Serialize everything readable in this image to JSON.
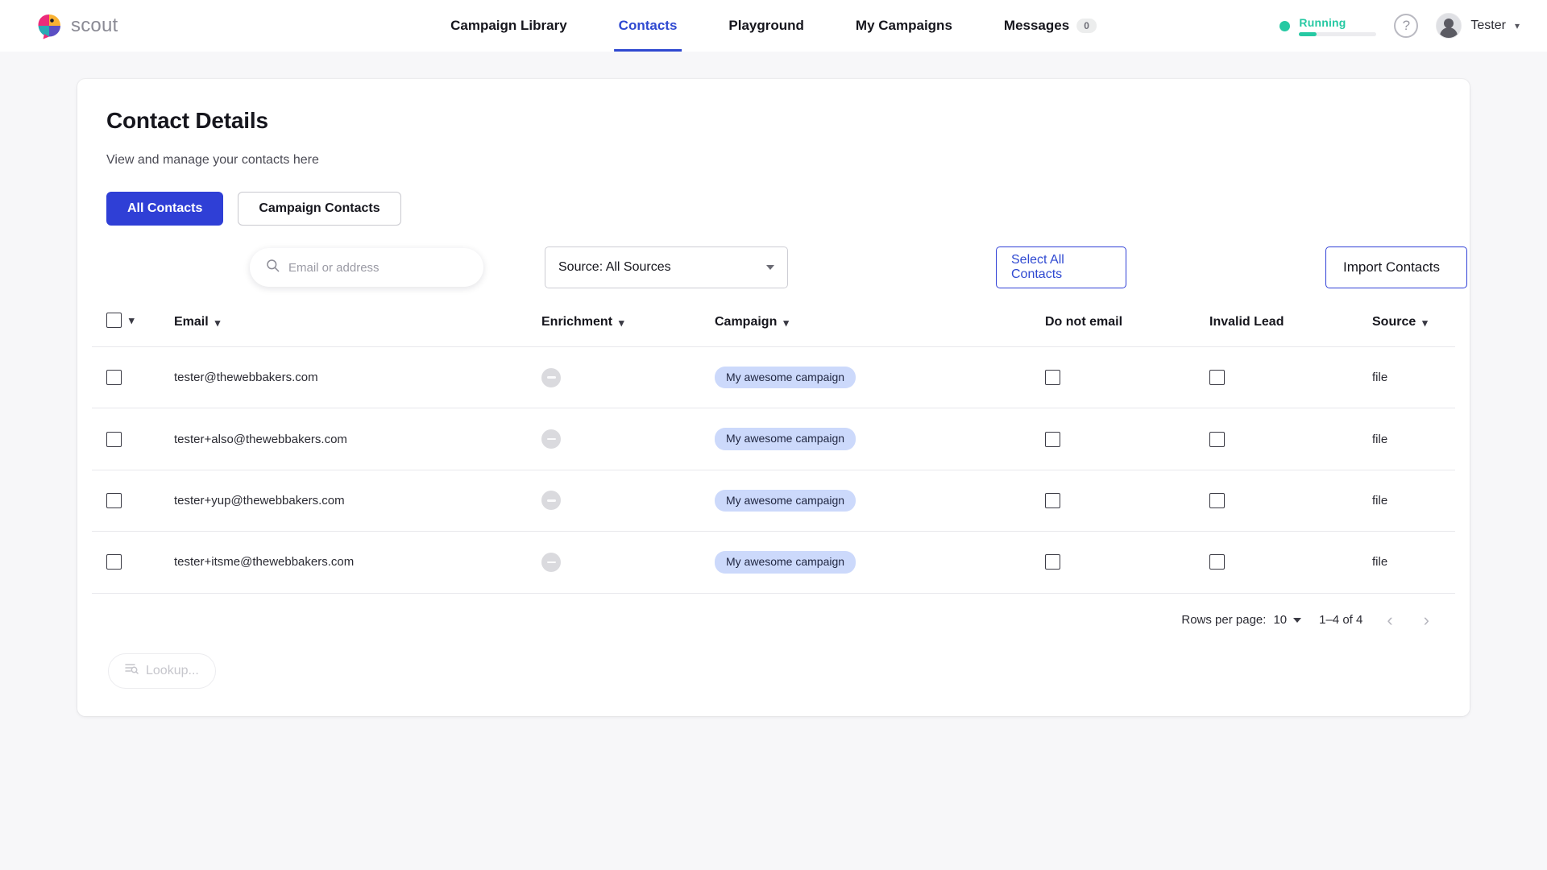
{
  "brand": {
    "name": "scout",
    "logo_icon": "parrot-logo-icon"
  },
  "nav": {
    "items": [
      {
        "label": "Campaign Library",
        "active": false
      },
      {
        "label": "Contacts",
        "active": true
      },
      {
        "label": "Playground",
        "active": false
      },
      {
        "label": "My Campaigns",
        "active": false
      }
    ],
    "messages": {
      "label": "Messages",
      "badge": "0"
    }
  },
  "topright": {
    "status_label": "Running",
    "status_color": "#26c9a3",
    "progress_percent": 22,
    "help_icon": "question-mark-icon",
    "avatar_icon": "user-avatar-icon",
    "user_name": "Tester",
    "caret_icon": "chevron-down-icon"
  },
  "page": {
    "title": "Contact Details",
    "subtitle": "View and manage your contacts here"
  },
  "tabs": [
    {
      "label": "All Contacts",
      "variant": "primary"
    },
    {
      "label": "Campaign Contacts",
      "variant": "ghost"
    }
  ],
  "filters": {
    "search_placeholder": "Email or address",
    "search_value": "",
    "search_icon": "search-icon",
    "source_select_value": "Source: All Sources",
    "select_all_label": "Select All Contacts",
    "import_label": "Import Contacts"
  },
  "table": {
    "columns": [
      {
        "key": "select",
        "label": "",
        "sortable": true
      },
      {
        "key": "email",
        "label": "Email",
        "sortable": true
      },
      {
        "key": "enrichment",
        "label": "Enrichment",
        "sortable": true
      },
      {
        "key": "campaign",
        "label": "Campaign",
        "sortable": true
      },
      {
        "key": "do_not_email",
        "label": "Do not email",
        "sortable": false
      },
      {
        "key": "invalid_lead",
        "label": "Invalid Lead",
        "sortable": false
      },
      {
        "key": "source",
        "label": "Source",
        "sortable": true
      }
    ],
    "rows": [
      {
        "email": "tester@thewebbakers.com",
        "enrichment_icon": "minus-circle-icon",
        "campaign": "My awesome campaign",
        "do_not_email": false,
        "invalid_lead": false,
        "source": "file"
      },
      {
        "email": "tester+also@thewebbakers.com",
        "enrichment_icon": "minus-circle-icon",
        "campaign": "My awesome campaign",
        "do_not_email": false,
        "invalid_lead": false,
        "source": "file"
      },
      {
        "email": "tester+yup@thewebbakers.com",
        "enrichment_icon": "minus-circle-icon",
        "campaign": "My awesome campaign",
        "do_not_email": false,
        "invalid_lead": false,
        "source": "file"
      },
      {
        "email": "tester+itsme@thewebbakers.com",
        "enrichment_icon": "minus-circle-icon",
        "campaign": "My awesome campaign",
        "do_not_email": false,
        "invalid_lead": false,
        "source": "file"
      }
    ]
  },
  "pagination": {
    "rows_per_page_label": "Rows per page:",
    "rows_per_page_value": "10",
    "range_label": "1–4 of 4",
    "prev_icon": "chevron-left-icon",
    "next_icon": "chevron-right-icon"
  },
  "footer": {
    "lookup_label": "Lookup...",
    "lookup_icon": "list-search-icon"
  },
  "colors": {
    "accent": "#2f3fd6",
    "accent_text": "#2f49d1",
    "chip_bg": "#ccd9fb",
    "status_green": "#26c9a3",
    "page_bg": "#f7f7f9"
  }
}
